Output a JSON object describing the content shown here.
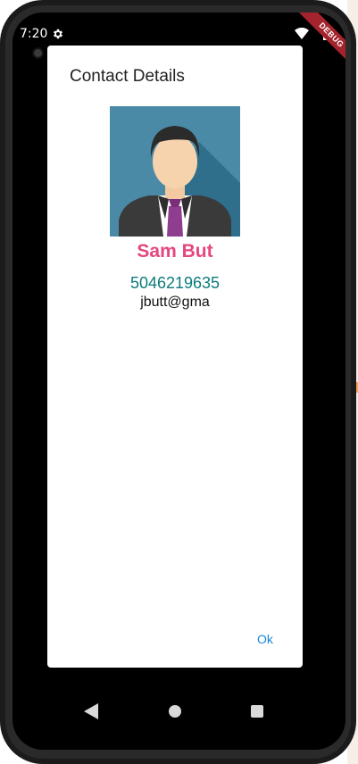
{
  "status_bar": {
    "time": "7:20",
    "debug_banner": "DEBUG"
  },
  "dialog": {
    "title": "Contact Details",
    "contact": {
      "name": "Sam But",
      "phone": "5046219635",
      "email": "jbutt@gma"
    },
    "ok_label": "Ok"
  },
  "colors": {
    "name": "#e64680",
    "phone": "#0d7b7d",
    "ok": "#1a86d9",
    "avatar_bg": "#4b8aa7"
  },
  "icons": [
    "gear-icon",
    "wifi-icon",
    "battery-icon",
    "back-icon",
    "home-icon",
    "recents-icon"
  ]
}
